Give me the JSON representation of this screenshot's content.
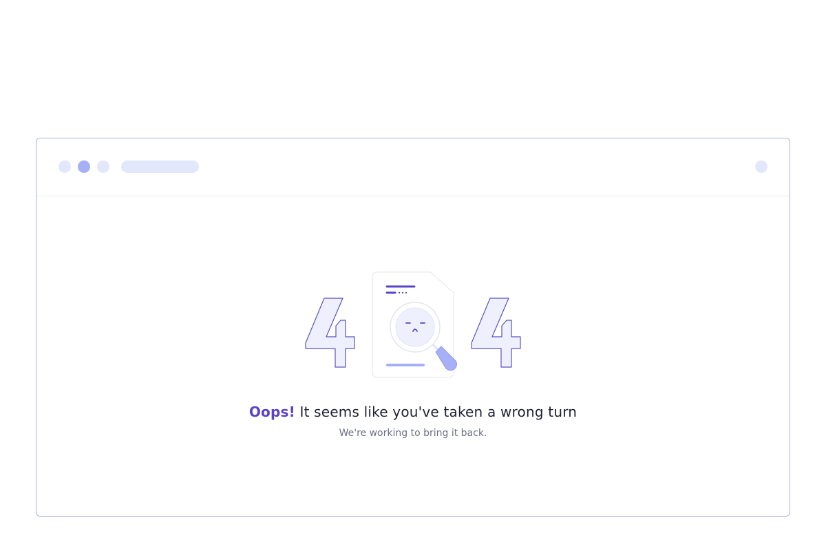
{
  "error_page": {
    "code_digit_left": "4",
    "code_digit_right": "4",
    "headline_accent": "Oops!",
    "headline_rest": " It seems like you've taken a wrong turn",
    "subtext": "We're working to bring it back."
  },
  "colors": {
    "accent": "#5a43c8",
    "frame_border": "#a9b0e0",
    "digit_fill": "#eef1fd",
    "digit_stroke": "#5a52c4",
    "placeholder": "#e3e7fb",
    "active_dot": "#a6b0f7"
  },
  "icons": [
    "document-icon",
    "magnifier-icon",
    "sad-face-icon"
  ]
}
